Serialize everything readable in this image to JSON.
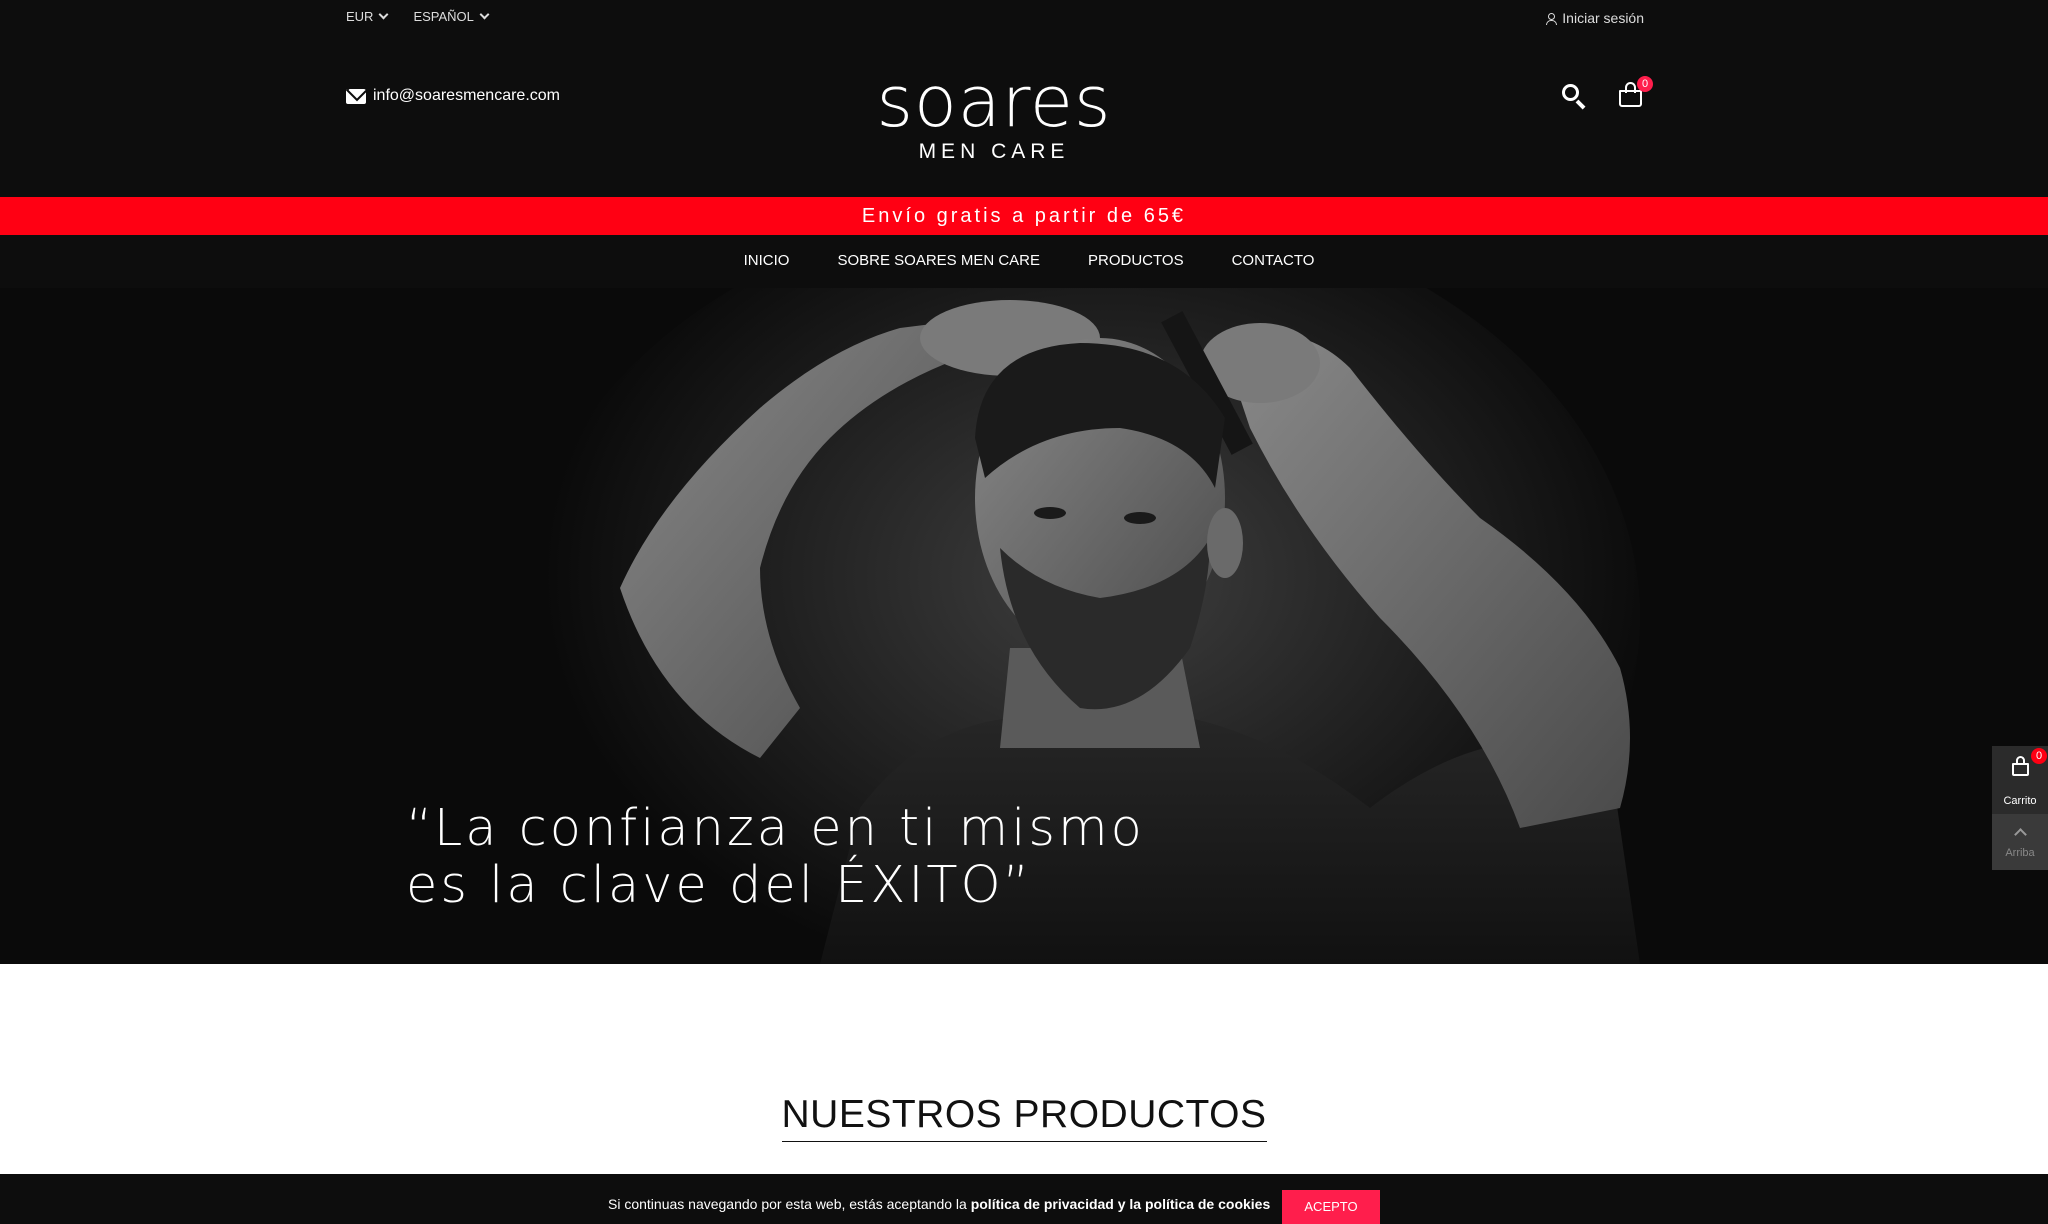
{
  "topbar": {
    "currency": "EUR",
    "language": "ESPAÑOL",
    "login": "Iniciar sesión"
  },
  "header": {
    "email": "info@soaresmencare.com",
    "logo_word": "soares",
    "logo_sub": "MEN CARE",
    "cart_count": "0",
    "icons": {
      "search": "search-icon",
      "cart": "shopping-bag-icon",
      "mail": "mail-icon",
      "user": "user-icon"
    }
  },
  "promo": "Envío gratis a partir de 65€",
  "nav": [
    "INICIO",
    "SOBRE SOARES MEN CARE",
    "PRODUCTOS",
    "CONTACTO"
  ],
  "hero": {
    "quote_line1": "“La confianza en ti mismo",
    "quote_line2": "es la clave del ÉXITO”"
  },
  "side_widget": {
    "cart_label": "Carrito",
    "cart_count": "0",
    "top_label": "Arriba"
  },
  "products": {
    "title": "NUESTROS PRODUCTOS"
  },
  "cookie": {
    "text_prefix": "Si continuas navegando por esta web, estás aceptando la ",
    "text_bold": "política de privacidad y la política de cookies",
    "accept": "ACEPTO"
  },
  "colors": {
    "accent": "#ff0013",
    "badge": "#ff1e4c",
    "dark": "#0d0d0d"
  }
}
